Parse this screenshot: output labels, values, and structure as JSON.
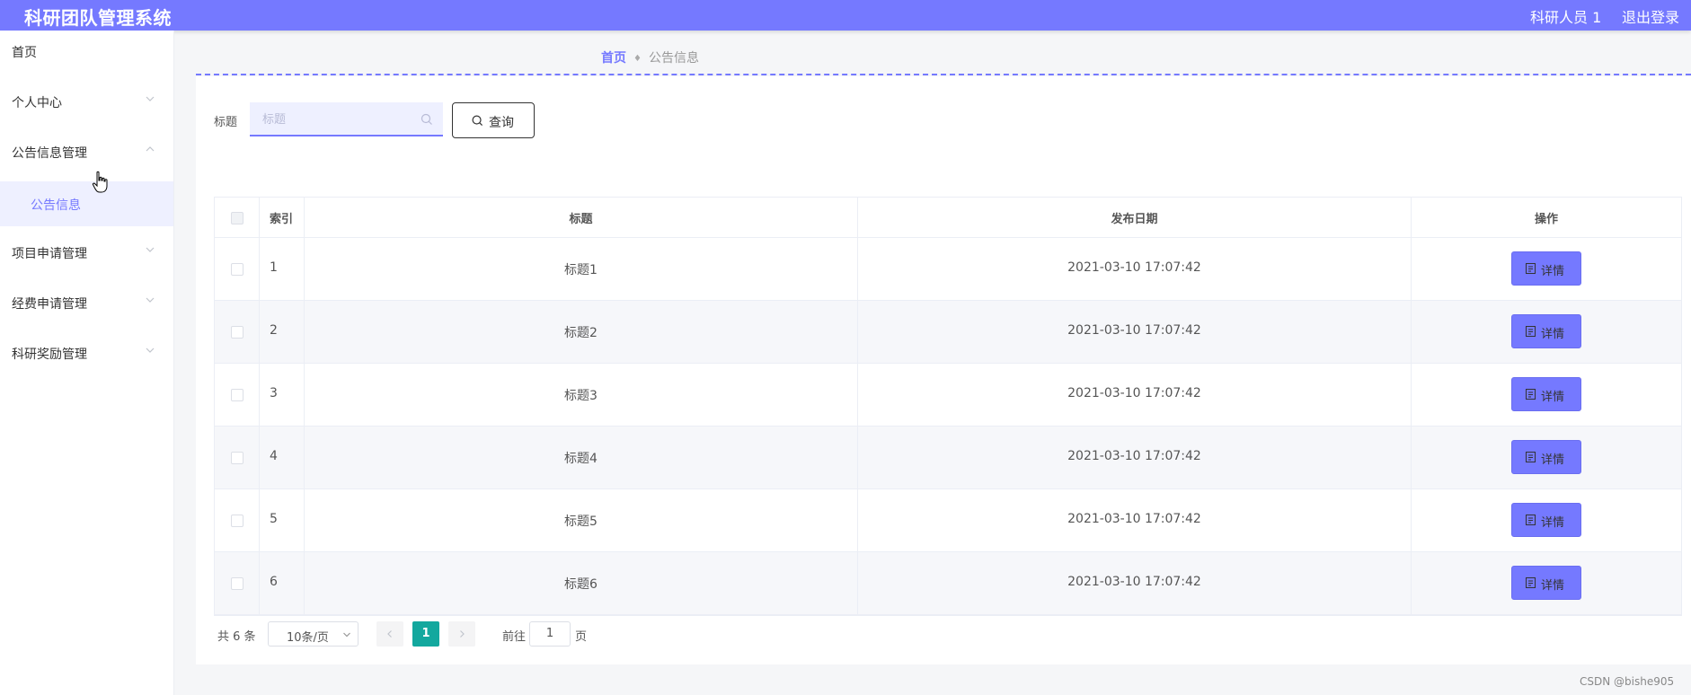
{
  "header": {
    "title": "科研团队管理系统",
    "user": "科研人员 1",
    "logout": "退出登录"
  },
  "sidebar": {
    "items": [
      {
        "label": "首页"
      },
      {
        "label": "个人中心"
      },
      {
        "label": "公告信息管理"
      },
      {
        "label": "项目申请管理"
      },
      {
        "label": "经费申请管理"
      },
      {
        "label": "科研奖励管理"
      }
    ],
    "active_sub": "公告信息"
  },
  "breadcrumb": {
    "home": "首页",
    "current": "公告信息"
  },
  "search": {
    "label": "标题",
    "placeholder": "标题",
    "button": "查询"
  },
  "table": {
    "headers": {
      "index": "索引",
      "title": "标题",
      "date": "发布日期",
      "action": "操作"
    },
    "detail_label": "详情",
    "rows": [
      {
        "index": "1",
        "title": "标题1",
        "date": "2021-03-10 17:07:42"
      },
      {
        "index": "2",
        "title": "标题2",
        "date": "2021-03-10 17:07:42"
      },
      {
        "index": "3",
        "title": "标题3",
        "date": "2021-03-10 17:07:42"
      },
      {
        "index": "4",
        "title": "标题4",
        "date": "2021-03-10 17:07:42"
      },
      {
        "index": "5",
        "title": "标题5",
        "date": "2021-03-10 17:07:42"
      },
      {
        "index": "6",
        "title": "标题6",
        "date": "2021-03-10 17:07:42"
      }
    ]
  },
  "pagination": {
    "total": "共 6 条",
    "page_size": "10条/页",
    "current_page": "1",
    "goto_label": "前往",
    "goto_value": "1",
    "page_unit": "页"
  },
  "watermark": "CSDN @bishe905",
  "colors": {
    "accent": "#7579ff",
    "page_active": "#13a89e"
  }
}
